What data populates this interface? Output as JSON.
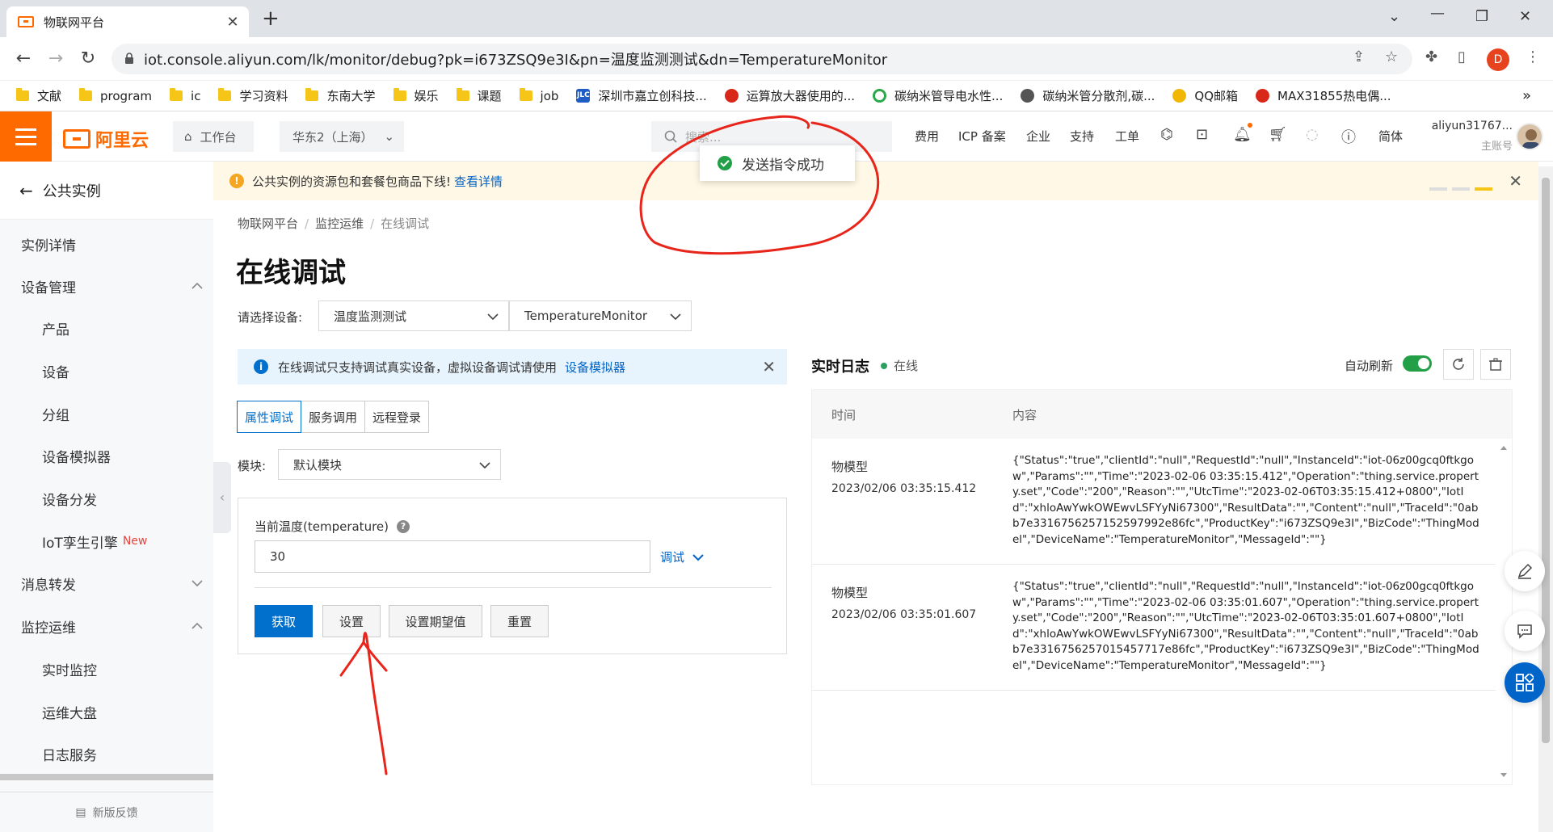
{
  "browser": {
    "tab_title": "物联网平台",
    "url": "iot.console.aliyun.com/lk/monitor/debug?pk=i673ZSQ9e3I&pn=温度监测测试&dn=TemperatureMonitor",
    "profile_initial": "D",
    "bookmarks": [
      {
        "label": "文献",
        "icon": "folder"
      },
      {
        "label": "program",
        "icon": "folder"
      },
      {
        "label": "ic",
        "icon": "folder"
      },
      {
        "label": "学习资料",
        "icon": "folder"
      },
      {
        "label": "东南大学",
        "icon": "folder"
      },
      {
        "label": "娱乐",
        "icon": "folder"
      },
      {
        "label": "课题",
        "icon": "folder"
      },
      {
        "label": "job",
        "icon": "folder"
      },
      {
        "label": "深圳市嘉立创科技...",
        "icon": "jlc"
      },
      {
        "label": "运算放大器使用的...",
        "icon": "site"
      },
      {
        "label": "碳纳米管导电水性...",
        "icon": "site"
      },
      {
        "label": "碳纳米管分散剂,碳...",
        "icon": "site"
      },
      {
        "label": "QQ邮箱",
        "icon": "qq"
      },
      {
        "label": "MAX31855热电偶...",
        "icon": "site"
      }
    ],
    "jlc_badge": "JLC",
    "more_bookmarks": "»"
  },
  "header": {
    "logo_text": "阿里云",
    "workbench": "工作台",
    "region": "华东2（上海）",
    "search_placeholder": "搜索...",
    "links": [
      "费用",
      "ICP 备案",
      "企业",
      "支持",
      "工单"
    ],
    "lang": "简体",
    "user_name": "aliyun31767...",
    "user_role": "主账号"
  },
  "sidebar": {
    "back_label": "公共实例",
    "items": [
      {
        "label": "实例详情",
        "level": 1
      },
      {
        "label": "设备管理",
        "level": 1,
        "expanded": true
      },
      {
        "label": "产品",
        "level": 2
      },
      {
        "label": "设备",
        "level": 2
      },
      {
        "label": "分组",
        "level": 2
      },
      {
        "label": "设备模拟器",
        "level": 2
      },
      {
        "label": "设备分发",
        "level": 2
      },
      {
        "label": "IoT孪生引擎",
        "level": 2,
        "badge": "New"
      },
      {
        "label": "消息转发",
        "level": 1,
        "expanded": false
      },
      {
        "label": "监控运维",
        "level": 1,
        "expanded": true
      },
      {
        "label": "实时监控",
        "level": 2
      },
      {
        "label": "运维大盘",
        "level": 2
      },
      {
        "label": "日志服务",
        "level": 2
      }
    ],
    "feedback": "新版反馈"
  },
  "notice": {
    "text": "公共实例的资源包和套餐包商品下线!",
    "link": "查看详情"
  },
  "breadcrumb": [
    "物联网平台",
    "监控运维",
    "在线调试"
  ],
  "page_title": "在线调试",
  "device_select": {
    "label": "请选择设备:",
    "product": "温度监测测试",
    "device": "TemperatureMonitor"
  },
  "info_bar": {
    "text": "在线调试只支持调试真实设备，虚拟设备调试请使用",
    "link": "设备模拟器"
  },
  "tabs": [
    {
      "label": "属性调试",
      "active": true
    },
    {
      "label": "服务调用",
      "active": false
    },
    {
      "label": "远程登录",
      "active": false
    }
  ],
  "module": {
    "label": "模块:",
    "value": "默认模块"
  },
  "property": {
    "label": "当前温度(temperature)",
    "value": "30",
    "debug_link": "调试"
  },
  "buttons": {
    "get": "获取",
    "set": "设置",
    "set_expected": "设置期望值",
    "reset": "重置"
  },
  "toast": {
    "text": "发送指令成功"
  },
  "log": {
    "title": "实时日志",
    "status": "在线",
    "auto_refresh": "自动刷新",
    "auto_refresh_on": true,
    "col_time": "时间",
    "col_content": "内容",
    "rows": [
      {
        "type": "物模型",
        "time": "2023/02/06 03:35:15.412",
        "content": "{\"Status\":\"true\",\"clientId\":\"null\",\"RequestId\":\"null\",\"InstanceId\":\"iot-06z00gcq0ftkgow\",\"Params\":\"\",\"Time\":\"2023-02-06 03:35:15.412\",\"Operation\":\"thing.service.property.set\",\"Code\":\"200\",\"Reason\":\"\",\"UtcTime\":\"2023-02-06T03:35:15.412+0800\",\"IotId\":\"xhloAwYwkOWEwvLSFYyNi67300\",\"ResultData\":\"\",\"Content\":\"null\",\"TraceId\":\"0abb7e3316756257152597992e86fc\",\"ProductKey\":\"i673ZSQ9e3I\",\"BizCode\":\"ThingModel\",\"DeviceName\":\"TemperatureMonitor\",\"MessageId\":\"\"}"
      },
      {
        "type": "物模型",
        "time": "2023/02/06 03:35:01.607",
        "content": "{\"Status\":\"true\",\"clientId\":\"null\",\"RequestId\":\"null\",\"InstanceId\":\"iot-06z00gcq0ftkgow\",\"Params\":\"\",\"Time\":\"2023-02-06 03:35:01.607\",\"Operation\":\"thing.service.property.set\",\"Code\":\"200\",\"Reason\":\"\",\"UtcTime\":\"2023-02-06T03:35:01.607+0800\",\"IotId\":\"xhloAwYwkOWEwvLSFYyNi67300\",\"ResultData\":\"\",\"Content\":\"null\",\"TraceId\":\"0abb7e3316756257015457717e86fc\",\"ProductKey\":\"i673ZSQ9e3I\",\"BizCode\":\"ThingModel\",\"DeviceName\":\"TemperatureMonitor\",\"MessageId\":\"\"}"
      }
    ]
  },
  "colors": {
    "brand": "#ff6a00",
    "primary": "#0070cc",
    "success": "#23a047",
    "annotation": "#e8251b"
  }
}
